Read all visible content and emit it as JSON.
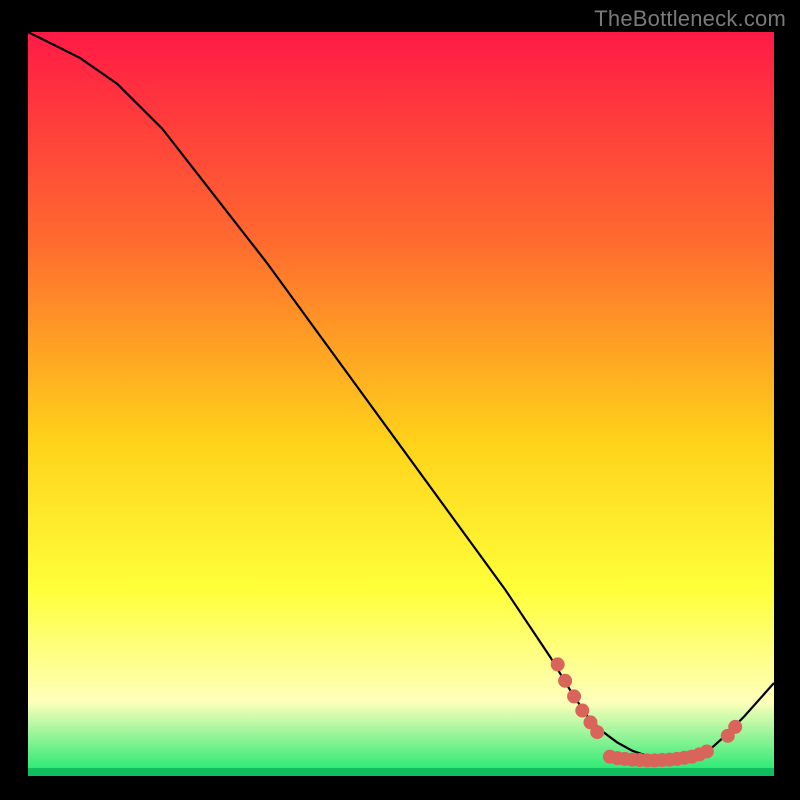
{
  "watermark": "TheBottleneck.com",
  "colors": {
    "black": "#000000",
    "line": "#000000",
    "marker": "#d9655a",
    "grad_top": "#ff1a46",
    "grad_mid1": "#ff6a2f",
    "grad_mid2": "#ffd21a",
    "grad_mid3": "#ffff3a",
    "grad_mid4": "#ffffbb",
    "grad_bottom": "#17e86f",
    "grad_bar": "#0fbf5c"
  },
  "chart_data": {
    "type": "line",
    "title": "",
    "xlabel": "",
    "ylabel": "",
    "xlim": [
      0,
      100
    ],
    "ylim": [
      0,
      100
    ],
    "x": [
      0,
      3,
      7,
      12,
      18,
      25,
      32,
      40,
      48,
      56,
      64,
      70,
      73,
      75,
      77,
      79,
      81,
      83,
      85,
      87,
      89,
      91,
      93,
      96,
      100
    ],
    "values": [
      100,
      98.5,
      96.5,
      93,
      87,
      78,
      69,
      58,
      47,
      36,
      25,
      16,
      11,
      8,
      6,
      4.5,
      3.4,
      2.7,
      2.2,
      2.0,
      2.3,
      3.2,
      5.0,
      8.0,
      12.5
    ],
    "markers": [
      {
        "x": 71.0,
        "y": 15.0
      },
      {
        "x": 72.0,
        "y": 12.8
      },
      {
        "x": 73.2,
        "y": 10.7
      },
      {
        "x": 74.3,
        "y": 8.8
      },
      {
        "x": 75.4,
        "y": 7.2
      },
      {
        "x": 76.3,
        "y": 5.9
      },
      {
        "x": 78.0,
        "y": 2.6
      },
      {
        "x": 79.0,
        "y": 2.4
      },
      {
        "x": 80.0,
        "y": 2.3
      },
      {
        "x": 81.0,
        "y": 2.2
      },
      {
        "x": 82.0,
        "y": 2.15
      },
      {
        "x": 83.0,
        "y": 2.1
      },
      {
        "x": 84.0,
        "y": 2.1
      },
      {
        "x": 85.0,
        "y": 2.15
      },
      {
        "x": 86.0,
        "y": 2.2
      },
      {
        "x": 87.0,
        "y": 2.3
      },
      {
        "x": 88.0,
        "y": 2.45
      },
      {
        "x": 89.0,
        "y": 2.6
      },
      {
        "x": 90.0,
        "y": 2.9
      },
      {
        "x": 91.0,
        "y": 3.3
      },
      {
        "x": 93.8,
        "y": 5.4
      },
      {
        "x": 94.8,
        "y": 6.6
      }
    ]
  }
}
